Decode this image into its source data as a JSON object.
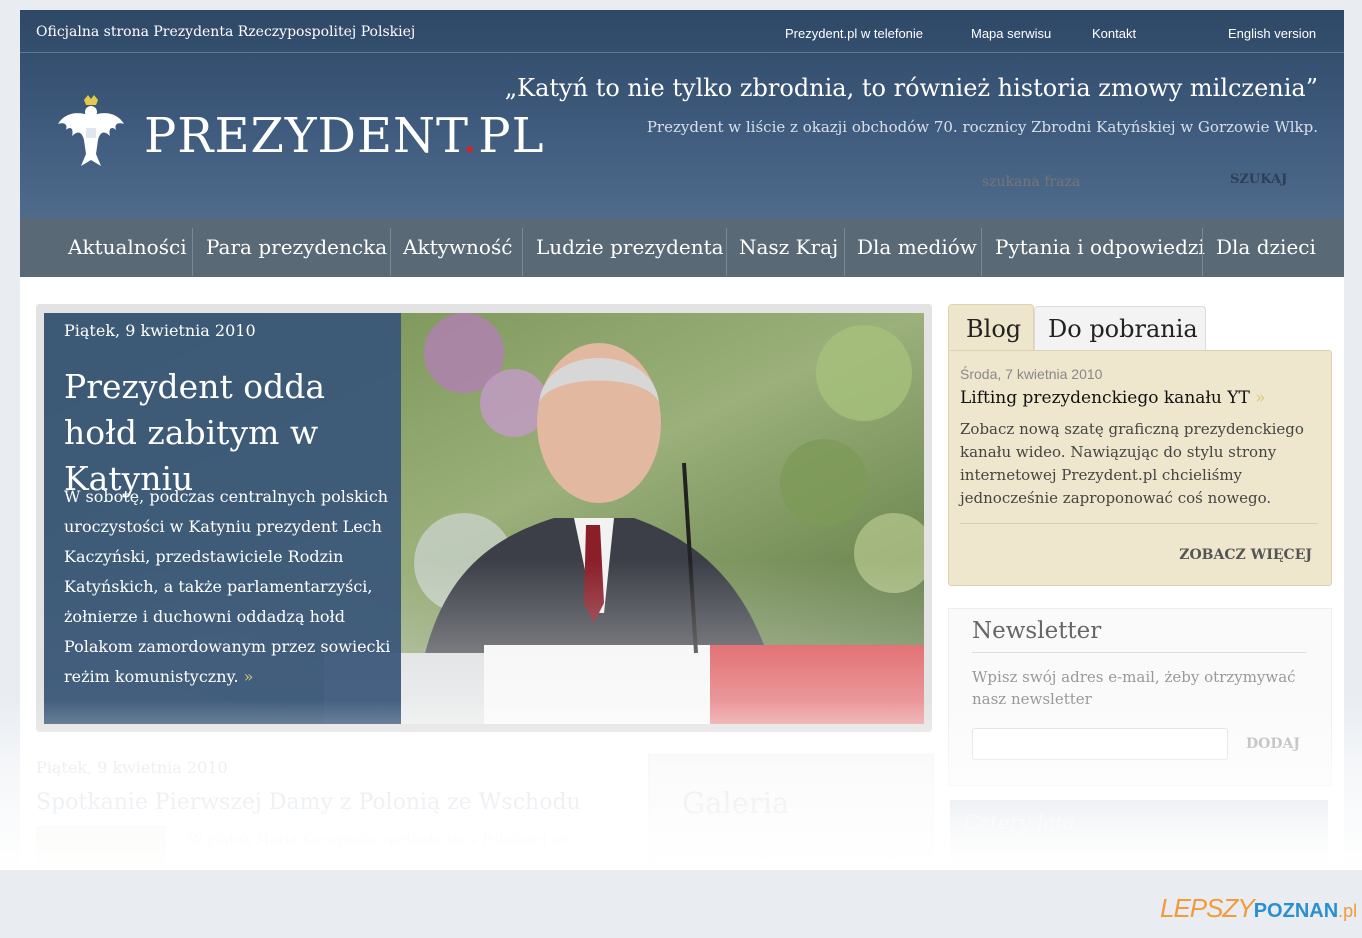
{
  "header": {
    "official": "Oficjalna strona Prezydenta Rzeczypospolitej Polskiej",
    "links": [
      "Prezydent.pl w telefonie",
      "Mapa serwisu",
      "Kontakt",
      "English version"
    ],
    "logo_main": "PREZYDENT",
    "logo_dot": ".",
    "logo_tld": "PL",
    "quote": "„Katyń to nie tylko zbrodnia, to również historia zmowy milczenia”",
    "quote_sub": "Prezydent w liście z okazji obchodów 70. rocznicy Zbrodni Katyńskiej w Gorzowie Wlkp.",
    "search_placeholder": "szukana fraza",
    "search_button": "SZUKAJ"
  },
  "nav": [
    "Aktualności",
    "Para prezydencka",
    "Aktywność",
    "Ludzie prezydenta",
    "Nasz Kraj",
    "Dla mediów",
    "Pytania i odpowiedzi",
    "Dla dzieci"
  ],
  "hero": {
    "date": "Piątek, 9 kwietnia 2010",
    "title": "Prezydent odda hołd zabitym w Katyniu",
    "text": "W sobotę, podczas centralnych polskich uroczystości w Katyniu prezydent Lech Kaczyński, przedstawiciele Rodzin Katyńskich, a także parlamentarzyści, żołnierze i duchowni oddadzą hołd Polakom zamordowanym przez sowiecki reżim komunistyczny.",
    "more": "»"
  },
  "tabs": [
    "Blog",
    "Do pobrania"
  ],
  "blog": {
    "date": "Środa, 7 kwietnia 2010",
    "title": "Lifting prezydenckiego kanału YT",
    "title_more": "»",
    "text": "Zobacz nową szatę graficzną prezydenckiego kanału wideo. Nawiązując do stylu strony internetowej Prezydent.pl chcieliśmy jednocześnie zaproponować coś nowego.",
    "more": "ZOBACZ WIĘCEJ"
  },
  "newsletter": {
    "title": "Newsletter",
    "text": "Wpisz swój adres e-mail, żeby otrzymywać nasz newsletter",
    "button": "DODAJ"
  },
  "news": {
    "date": "Piątek, 9 kwietnia 2010",
    "title": "Spotkanie Pierwszej Damy z Polonią ze Wschodu",
    "text": "W piątek Maria Kaczyńska spotkała się z Polakami ze"
  },
  "gallery": {
    "title": "Galeria"
  },
  "cztery": {
    "label": "Cztery lata"
  },
  "watermark": {
    "a": "LEPSZY",
    "b": "POZNAN",
    "c": ".pl"
  },
  "colors": {
    "header": "#3e5a7c",
    "nav": "#596a76",
    "blog_bg": "#eee7cd",
    "accent_red": "#d2232a"
  }
}
